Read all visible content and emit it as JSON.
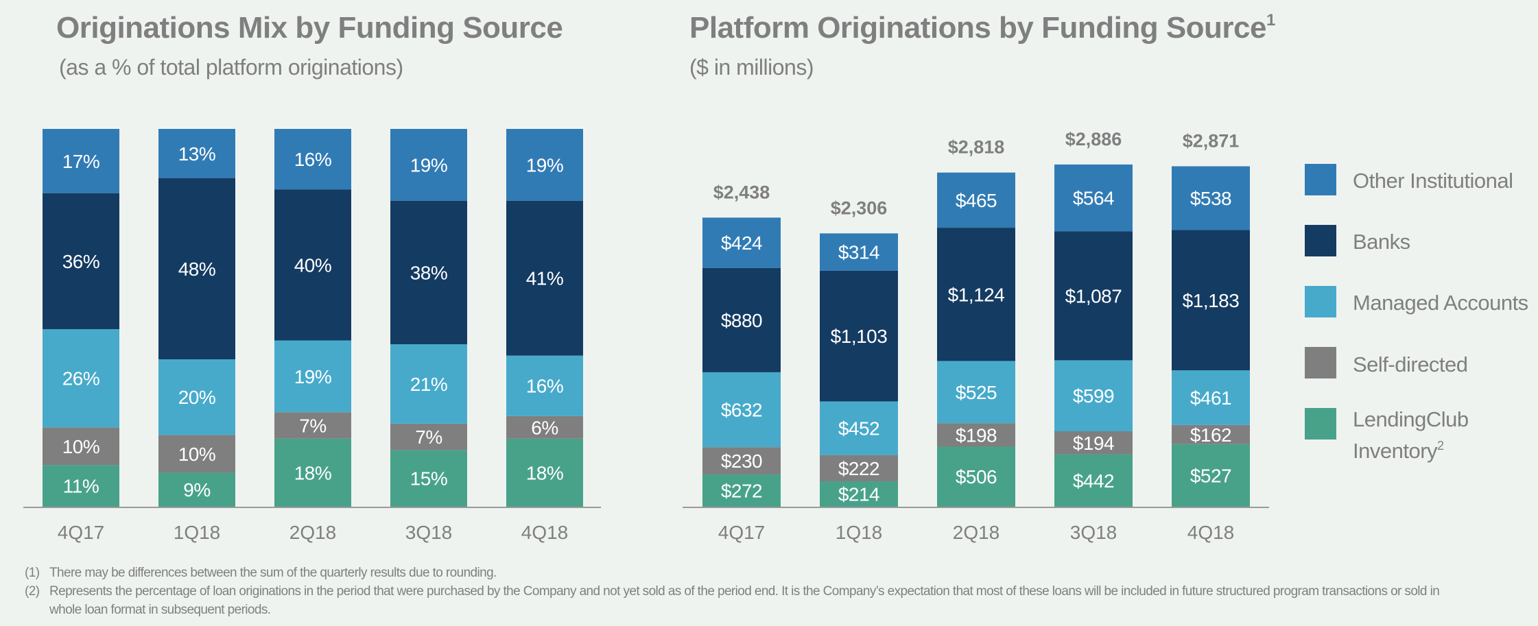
{
  "chart_data": [
    {
      "type": "bar",
      "stacked": true,
      "title": "Originations Mix by Funding Source",
      "subtitle": "(as a % of total platform originations)",
      "xlabel": "",
      "ylabel": "",
      "ylim": [
        0,
        100
      ],
      "grid": false,
      "categories": [
        "4Q17",
        "1Q18",
        "2Q18",
        "3Q18",
        "4Q18"
      ],
      "series": [
        {
          "name": "LendingClub Inventory",
          "color": "#48a28a",
          "values": [
            11,
            9,
            18,
            15,
            18
          ],
          "labels": [
            "11%",
            "9%",
            "18%",
            "15%",
            "18%"
          ]
        },
        {
          "name": "Self-directed",
          "color": "#7f7f7f",
          "values": [
            10,
            10,
            7,
            7,
            6
          ],
          "labels": [
            "10%",
            "10%",
            "7%",
            "7%",
            "6%"
          ]
        },
        {
          "name": "Managed Accounts",
          "color": "#47aacb",
          "values": [
            26,
            20,
            19,
            21,
            16
          ],
          "labels": [
            "26%",
            "20%",
            "19%",
            "21%",
            "16%"
          ]
        },
        {
          "name": "Banks",
          "color": "#143b62",
          "values": [
            36,
            48,
            40,
            38,
            41
          ],
          "labels": [
            "36%",
            "48%",
            "40%",
            "38%",
            "41%"
          ]
        },
        {
          "name": "Other Institutional",
          "color": "#317bb5",
          "values": [
            17,
            13,
            16,
            19,
            19
          ],
          "labels": [
            "17%",
            "13%",
            "16%",
            "19%",
            "19%"
          ]
        }
      ]
    },
    {
      "type": "bar",
      "stacked": true,
      "title": "Platform Originations by Funding Source",
      "title_superscript": "1",
      "subtitle": "($ in millions)",
      "xlabel": "",
      "ylabel": "",
      "ylim": [
        0,
        3200
      ],
      "grid": false,
      "legend": "right",
      "categories": [
        "4Q17",
        "1Q18",
        "2Q18",
        "3Q18",
        "4Q18"
      ],
      "totals": [
        2438,
        2306,
        2818,
        2886,
        2871
      ],
      "total_labels": [
        "$2,438",
        "$2,306",
        "$2,818",
        "$2,886",
        "$2,871"
      ],
      "series": [
        {
          "name": "LendingClub Inventory",
          "color": "#48a28a",
          "values": [
            272,
            214,
            506,
            442,
            527
          ],
          "labels": [
            "$272",
            "$214",
            "$506",
            "$442",
            "$527"
          ]
        },
        {
          "name": "Self-directed",
          "color": "#7f7f7f",
          "values": [
            230,
            222,
            198,
            194,
            162
          ],
          "labels": [
            "$230",
            "$222",
            "$198",
            "$194",
            "$162"
          ]
        },
        {
          "name": "Managed Accounts",
          "color": "#47aacb",
          "values": [
            632,
            452,
            525,
            599,
            461
          ],
          "labels": [
            "$632",
            "$452",
            "$525",
            "$599",
            "$461"
          ]
        },
        {
          "name": "Banks",
          "color": "#143b62",
          "values": [
            880,
            1103,
            1124,
            1087,
            1183
          ],
          "labels": [
            "$880",
            "$1,103",
            "$1,124",
            "$1,087",
            "$1,183"
          ]
        },
        {
          "name": "Other Institutional",
          "color": "#317bb5",
          "values": [
            424,
            314,
            465,
            564,
            538
          ],
          "labels": [
            "$424",
            "$314",
            "$465",
            "$564",
            "$538"
          ]
        }
      ]
    }
  ],
  "legend": {
    "items": [
      {
        "label": "Other Institutional",
        "sup": "",
        "color": "#317bb5"
      },
      {
        "label": "Banks",
        "sup": "",
        "color": "#143b62"
      },
      {
        "label": "Managed Accounts",
        "sup": "",
        "color": "#47aacb"
      },
      {
        "label": "Self-directed",
        "sup": "",
        "color": "#7f7f7f"
      },
      {
        "label": "LendingClub",
        "label2": "Inventory",
        "sup": "2",
        "color": "#48a28a"
      }
    ]
  },
  "footnotes": [
    {
      "num": "(1)",
      "text": "There may be differences between the sum of the quarterly results due to rounding."
    },
    {
      "num": "(2)",
      "text": "Represents the percentage of loan originations in the period that were purchased by the Company and not yet sold as of the period end. It is the Company’s expectation that most of these loans will be included in future structured program transactions or sold in whole loan format in subsequent periods."
    }
  ]
}
